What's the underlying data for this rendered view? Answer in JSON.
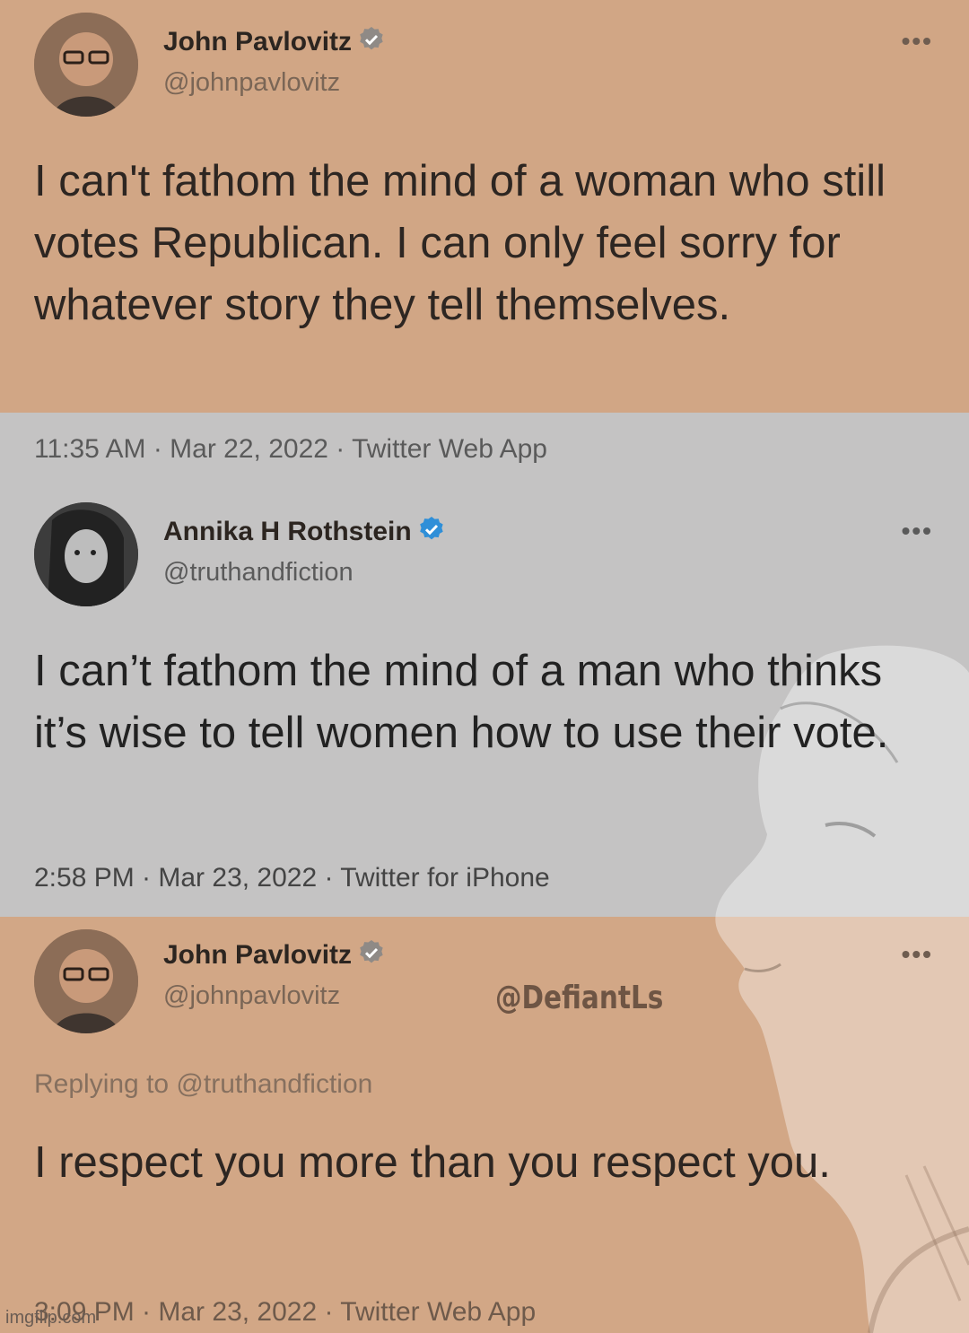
{
  "colors": {
    "band_top": "#d1a685",
    "band_middle": "#c4c3c3",
    "band_bottom": "#d2a786",
    "verified_blue": "#2f8fd8"
  },
  "tweets": [
    {
      "author": "John Pavlovitz",
      "handle": "@johnpavlovitz",
      "verified": true,
      "more_icon": "more-horizontal-icon",
      "replying_to": "",
      "text": "I can't fathom the mind of a woman who still votes Republican. I can only feel sorry for whatever story they tell themselves.",
      "meta": "11:35 AM · Mar 22, 2022 · Twitter Web App"
    },
    {
      "author": "Annika H Rothstein",
      "handle": "@truthandfiction",
      "verified": true,
      "more_icon": "more-horizontal-icon",
      "replying_to": "",
      "text": "I can’t fathom the mind of a man who thinks it’s wise to tell women how to use their vote.",
      "meta": "2:58 PM · Mar 23, 2022 · Twitter for iPhone"
    },
    {
      "author": "John Pavlovitz",
      "handle": "@johnpavlovitz",
      "verified": true,
      "more_icon": "more-horizontal-icon",
      "replying_to": "Replying to @truthandfiction",
      "text": "I respect you more than you respect you.",
      "meta": "3:09 PM · Mar 23, 2022 · Twitter Web App"
    }
  ],
  "overlay_tag": "@DefiantLs",
  "imgflip_mark": "imgflip.com"
}
